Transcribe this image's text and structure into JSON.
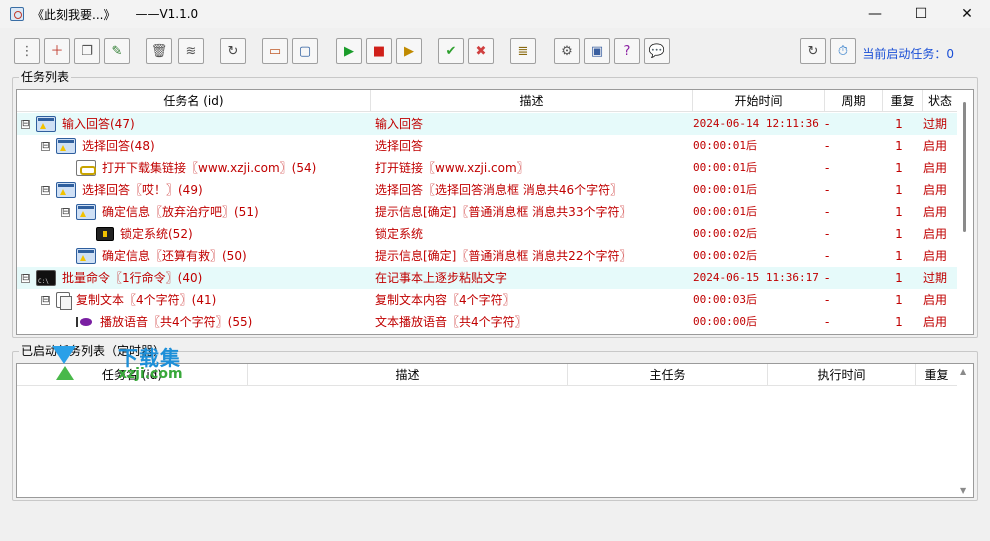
{
  "window": {
    "title": "《此刻我要...》",
    "version": "——V1.1.0",
    "minimize": "—",
    "maximize": "☐",
    "close": "✕"
  },
  "toolbar": {
    "buttons": [
      {
        "name": "new-task-button",
        "glyph": "⋮"
      },
      {
        "name": "add-task-button",
        "glyph": "＋"
      },
      {
        "name": "copy-task-button",
        "glyph": "❐"
      },
      {
        "name": "edit-task-button",
        "glyph": "✎"
      },
      {
        "name": "delete-button",
        "glyph": "🗑"
      },
      {
        "name": "clear-button",
        "glyph": "≋"
      },
      {
        "name": "refresh-button",
        "glyph": "↻"
      },
      {
        "name": "window-small-button",
        "glyph": "▭"
      },
      {
        "name": "window-large-button",
        "glyph": "▢"
      },
      {
        "name": "run-button",
        "glyph": "▶"
      },
      {
        "name": "stop-button",
        "glyph": "■"
      },
      {
        "name": "run-selected-button",
        "glyph": "▶"
      },
      {
        "name": "enable-button",
        "glyph": "✔"
      },
      {
        "name": "disable-button",
        "glyph": "✖"
      },
      {
        "name": "log-button",
        "glyph": "≣"
      },
      {
        "name": "settings-button",
        "glyph": "⚙"
      },
      {
        "name": "about-button",
        "glyph": "▣"
      },
      {
        "name": "help-button",
        "glyph": "?"
      },
      {
        "name": "chat-button",
        "glyph": "💬"
      },
      {
        "name": "reload-button",
        "glyph": "↻"
      },
      {
        "name": "timer-button",
        "glyph": "⏱"
      }
    ],
    "status_label": "当前启动任务：",
    "status_count": "0"
  },
  "task_list": {
    "group_title": "任务列表",
    "columns": [
      "任务名 (id)",
      "描述",
      "开始时间",
      "周期",
      "重复",
      "状态"
    ],
    "rows": [
      {
        "indent": 0,
        "expander": "⊟",
        "icon": "win",
        "name": "输入回答(47)",
        "desc": "输入回答",
        "start": "2024-06-14 12:11:36",
        "cycle": "-",
        "repeat": "1",
        "status": "过期",
        "highlight": true
      },
      {
        "indent": 1,
        "expander": "⊟",
        "icon": "win",
        "name": "选择回答(48)",
        "desc": "选择回答",
        "start": "00:00:01后",
        "cycle": "-",
        "repeat": "1",
        "status": "启用",
        "highlight": false
      },
      {
        "indent": 2,
        "expander": "",
        "icon": "link",
        "name": "打开下载集链接〖www.xzji.com〗(54)",
        "desc": "打开链接〖www.xzji.com〗",
        "start": "00:00:01后",
        "cycle": "-",
        "repeat": "1",
        "status": "启用",
        "highlight": false
      },
      {
        "indent": 1,
        "expander": "⊟",
        "icon": "win",
        "name": "选择回答〖哎！〗(49)",
        "desc": "选择回答〖选择回答消息框 消息共46个字符〗",
        "start": "00:00:01后",
        "cycle": "-",
        "repeat": "1",
        "status": "启用",
        "highlight": false
      },
      {
        "indent": 2,
        "expander": "⊟",
        "icon": "win",
        "name": "确定信息〖放弃治疗吧〗(51)",
        "desc": "提示信息[确定]〖普通消息框 消息共33个字符〗",
        "start": "00:00:01后",
        "cycle": "-",
        "repeat": "1",
        "status": "启用",
        "highlight": false
      },
      {
        "indent": 3,
        "expander": "",
        "icon": "lock",
        "name": "锁定系统(52)",
        "desc": "锁定系统",
        "start": "00:00:02后",
        "cycle": "-",
        "repeat": "1",
        "status": "启用",
        "highlight": false
      },
      {
        "indent": 2,
        "expander": "",
        "icon": "win",
        "name": "确定信息〖还算有救〗(50)",
        "desc": "提示信息[确定]〖普通消息框 消息共22个字符〗",
        "start": "00:00:02后",
        "cycle": "-",
        "repeat": "1",
        "status": "启用",
        "highlight": false
      },
      {
        "indent": 0,
        "expander": "⊟",
        "icon": "cmd",
        "name": "批量命令〖1行命令〗(40)",
        "desc": "在记事本上逐步粘贴文字",
        "start": "2024-06-15 11:36:17",
        "cycle": "-",
        "repeat": "1",
        "status": "过期",
        "highlight": true
      },
      {
        "indent": 1,
        "expander": "⊟",
        "icon": "copy",
        "name": "复制文本〖4个字符〗(41)",
        "desc": "复制文本内容〖4个字符〗",
        "start": "00:00:03后",
        "cycle": "-",
        "repeat": "1",
        "status": "启用",
        "highlight": false
      },
      {
        "indent": 2,
        "expander": "",
        "icon": "voice",
        "name": "播放语音〖共4个字符〗(55)",
        "desc": "文本播放语音〖共4个字符〗",
        "start": "00:00:00后",
        "cycle": "-",
        "repeat": "1",
        "status": "启用",
        "highlight": false
      }
    ]
  },
  "started_list": {
    "group_title": "已启动任务列表（定时器）",
    "columns": [
      "任务名 (id)",
      "描述",
      "主任务",
      "执行时间",
      "重复"
    ]
  },
  "watermark": {
    "line1": "下载集",
    "line2": "xzji.com"
  }
}
